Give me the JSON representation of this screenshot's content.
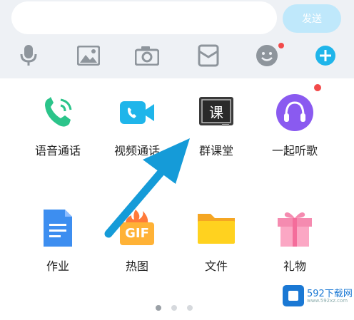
{
  "input": {
    "placeholder": ""
  },
  "send_label": "发送",
  "toolbar": [
    {
      "name": "voice-icon"
    },
    {
      "name": "image-icon"
    },
    {
      "name": "camera-icon"
    },
    {
      "name": "red-packet-icon"
    },
    {
      "name": "emoji-icon",
      "badge": true
    },
    {
      "name": "plus-icon"
    }
  ],
  "apps": [
    {
      "label": "语音通话",
      "icon": "phone-call-icon",
      "color": "#2bc48a"
    },
    {
      "label": "视频通话",
      "icon": "video-call-icon",
      "color": "#1fb5ea"
    },
    {
      "label": "群课堂",
      "icon": "classroom-icon",
      "color": "#3a3a3a",
      "glyph": "课"
    },
    {
      "label": "一起听歌",
      "icon": "headphones-icon",
      "color": "#8a5af0",
      "badge": true
    },
    {
      "label": "作业",
      "icon": "homework-doc-icon",
      "color": "#3d8ef0"
    },
    {
      "label": "热图",
      "icon": "gif-icon",
      "color": "#ffb236",
      "glyph": "GIF"
    },
    {
      "label": "文件",
      "icon": "folder-icon",
      "color": "#ffc91f"
    },
    {
      "label": "礼物",
      "icon": "gift-icon",
      "color": "#f58bb0"
    }
  ],
  "pager": {
    "pages": 3,
    "current": 1
  },
  "watermark": {
    "text": "592下载网",
    "sub": "www.592xz.com"
  },
  "colors": {
    "accent": "#1fa7e0",
    "badge": "#f24a4a",
    "arrow": "#159bd8"
  }
}
